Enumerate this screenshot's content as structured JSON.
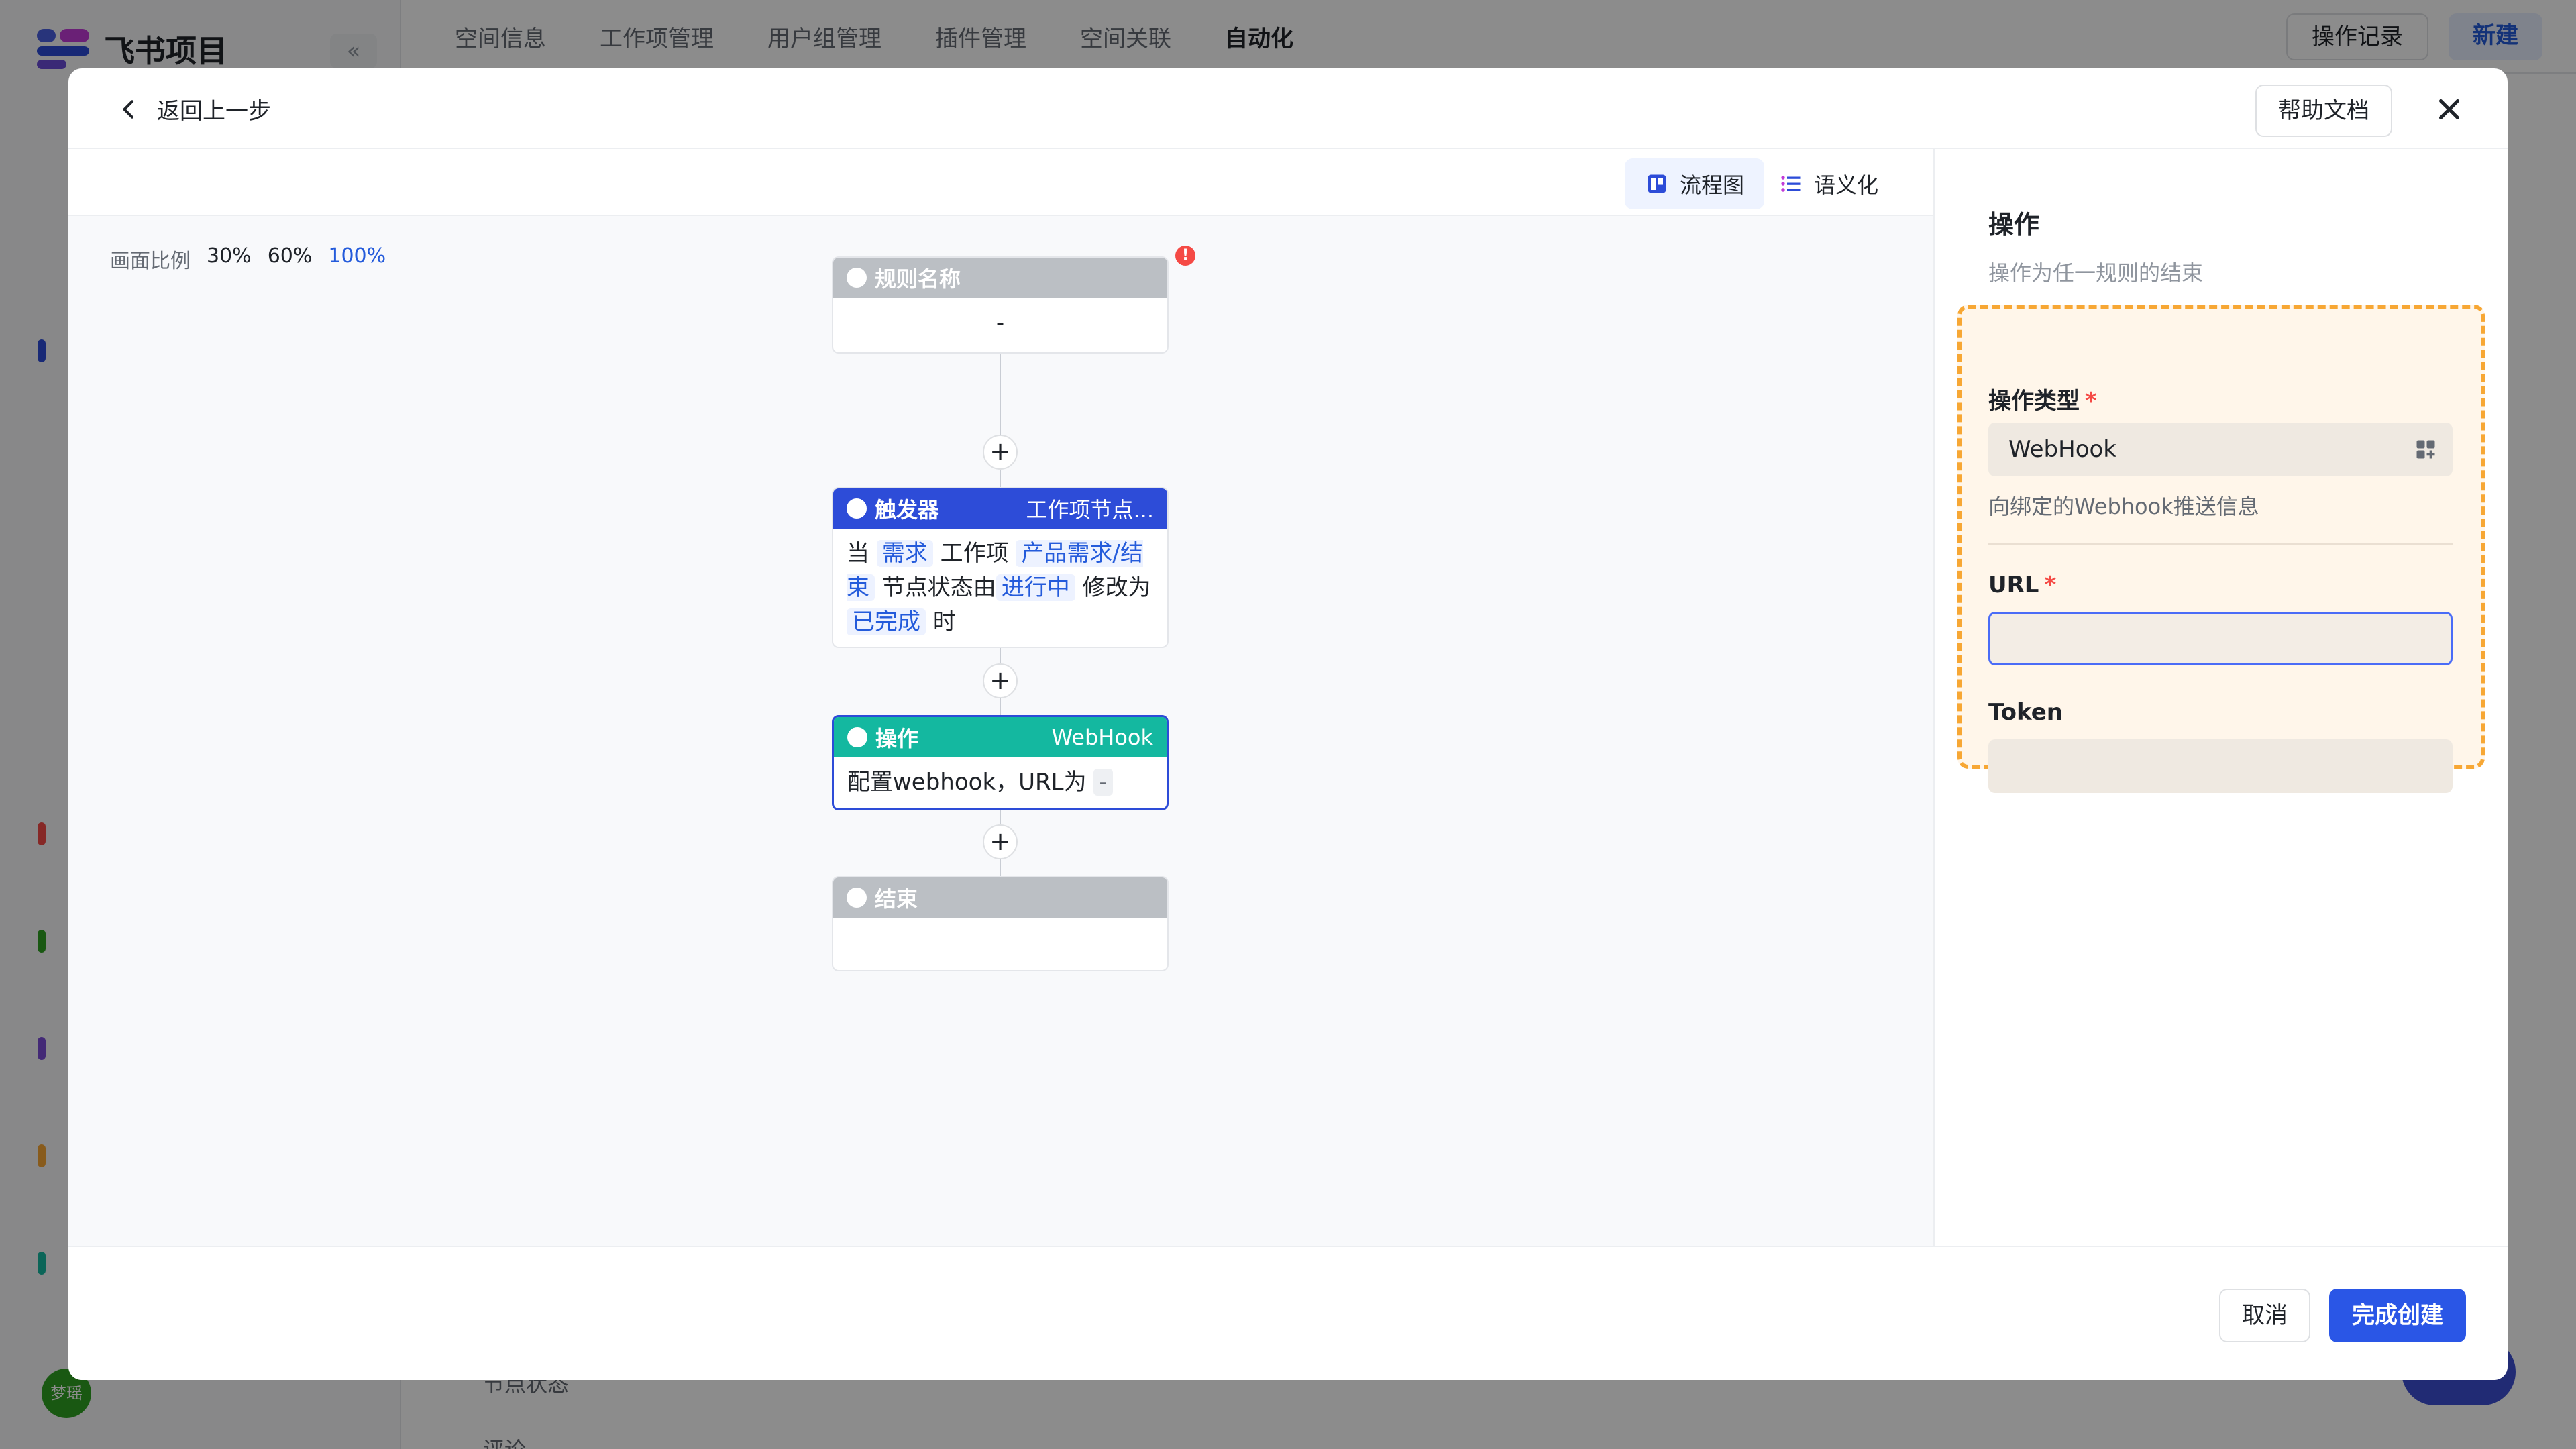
{
  "background": {
    "logo_text": "飞书项目",
    "nav_items": [
      "空间信息",
      "工作项管理",
      "用户组管理",
      "插件管理",
      "空间关联",
      "自动化"
    ],
    "active_nav": "自动化",
    "log_btn": "操作记录",
    "new_btn": "新建",
    "avatar_text": "梦瑶",
    "bottom_item_1": "节点状态",
    "bottom_item_2": "评论"
  },
  "modal": {
    "back_label": "返回上一步",
    "help_label": "帮助文档",
    "view_tabs": {
      "flow": "流程图",
      "semantic": "语义化"
    },
    "zoom": {
      "label": "画面比例",
      "options": [
        "30%",
        "60%",
        "100%"
      ],
      "active": "100%"
    },
    "nodes": {
      "rule": {
        "title": "规则名称",
        "body": "-"
      },
      "trigger": {
        "title": "触发器",
        "right": "工作项节点...",
        "t1": "当",
        "c1": "需求",
        "t2": "工作项",
        "c2": "产品需求/结束",
        "t3": "节点状态由",
        "c3": "进行中",
        "t4": "修改为",
        "c4": "已完成",
        "t5": "时"
      },
      "action": {
        "title": "操作",
        "right": "WebHook",
        "text": "配置webhook，URL为",
        "chip": "-"
      },
      "end": {
        "title": "结束"
      }
    },
    "panel": {
      "title": "操作",
      "desc": "操作为任一规则的结束",
      "type_label": "操作类型",
      "type_value": "WebHook",
      "type_hint": "向绑定的Webhook推送信息",
      "url_label": "URL",
      "token_label": "Token",
      "required_mark": "*"
    },
    "footer": {
      "cancel": "取消",
      "submit": "完成创建"
    }
  },
  "colors": {
    "primary": "#2a56e6",
    "trigger": "#2d4cd8",
    "action": "#14b8a0",
    "highlight": "#f7a734",
    "danger": "#f54a45"
  }
}
